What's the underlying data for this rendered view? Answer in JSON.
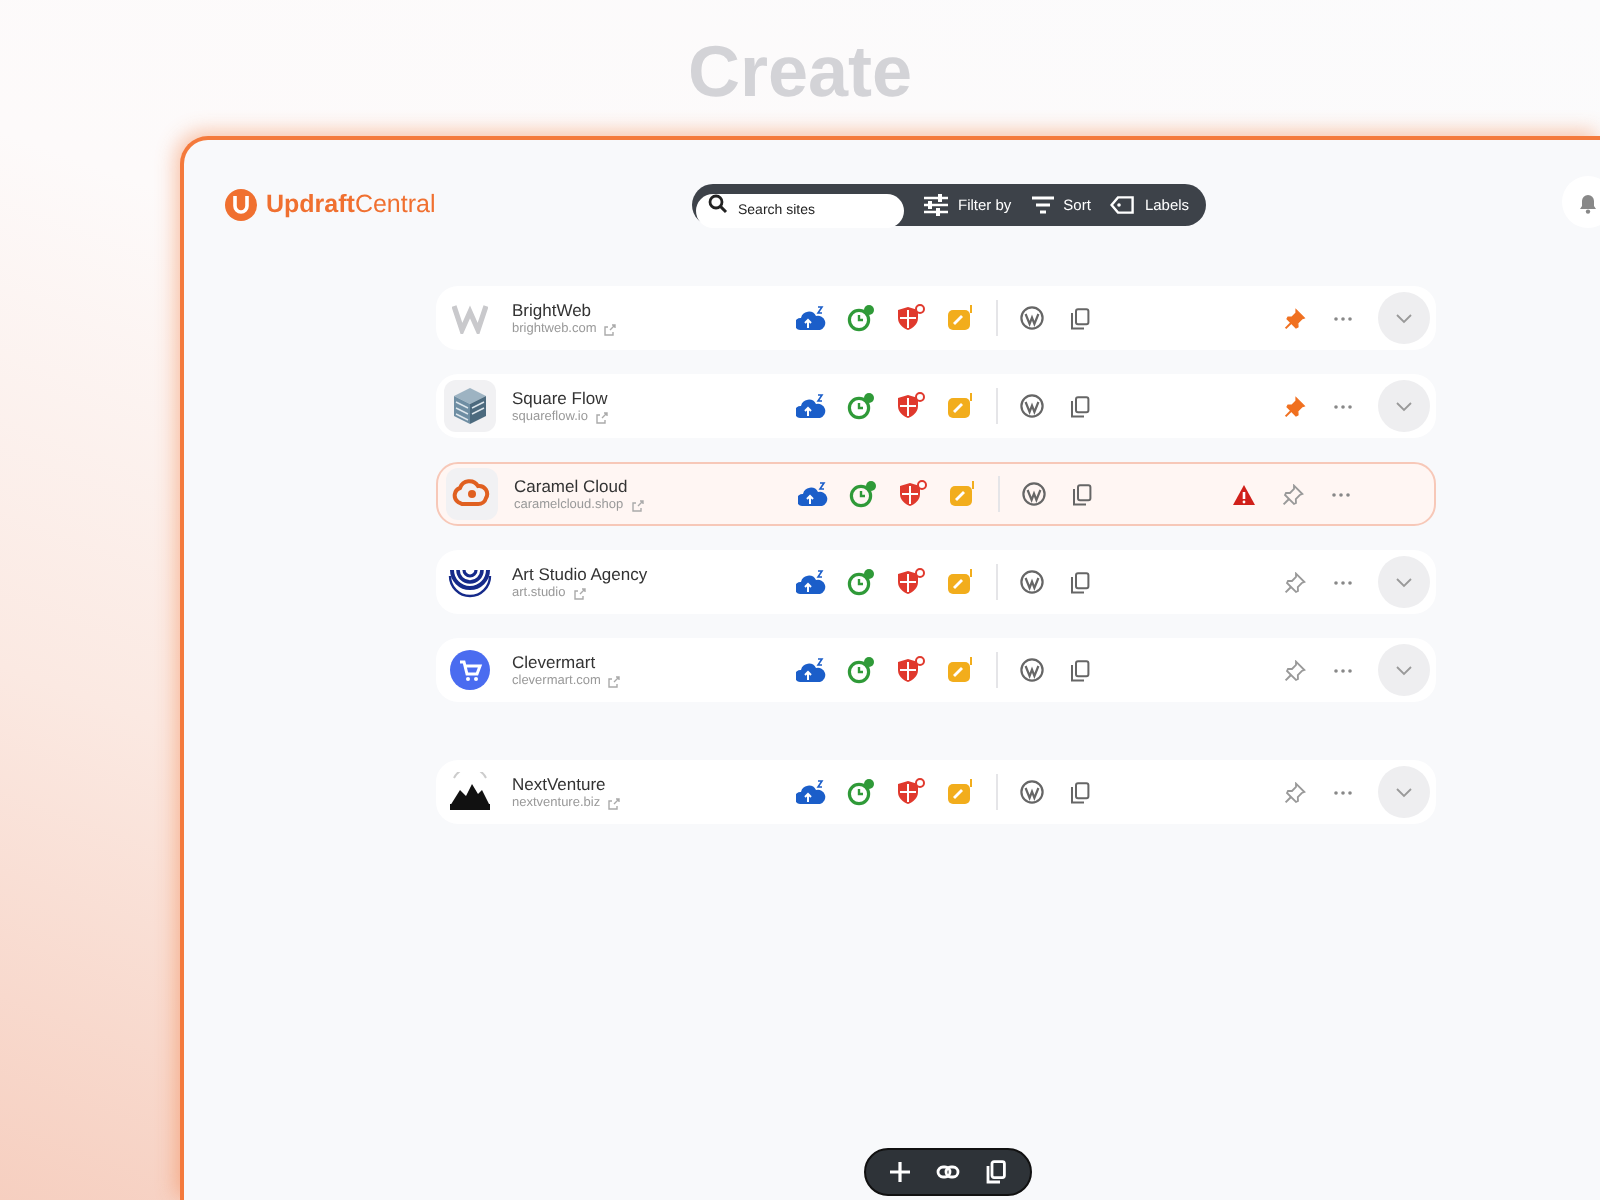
{
  "heading": "Create",
  "app": {
    "brand": "**Updraft**Central",
    "search": {
      "placeholder": "Search sites"
    },
    "toolbar_buttons": [
      {
        "label": "Filter by",
        "kind": "filter"
      },
      {
        "label": "Sort",
        "kind": "sort"
      },
      {
        "label": "Labels",
        "kind": "labels"
      }
    ],
    "site_groups": [
      {
        "sites": [
          {
            "name": "BrightWeb",
            "url": "brightweb.com",
            "pinned": true,
            "alert": false,
            "expandable": true
          },
          {
            "name": "Square Flow",
            "url": "squareflow.io",
            "pinned": true,
            "alert": false,
            "expandable": true
          },
          {
            "name": "Caramel Cloud",
            "url": "caramelcloud.shop",
            "pinned": false,
            "alert": true,
            "expandable": false
          },
          {
            "name": "Art Studio Agency",
            "url": "art.studio",
            "pinned": false,
            "alert": false,
            "expandable": true
          },
          {
            "name": "Clevermart",
            "url": "clevermart.com",
            "pinned": false,
            "alert": false,
            "expandable": true
          }
        ]
      },
      {
        "sites": [
          {
            "name": "NextVenture",
            "url": "nextventure.biz",
            "pinned": false,
            "alert": false,
            "expandable": true
          }
        ]
      }
    ]
  }
}
